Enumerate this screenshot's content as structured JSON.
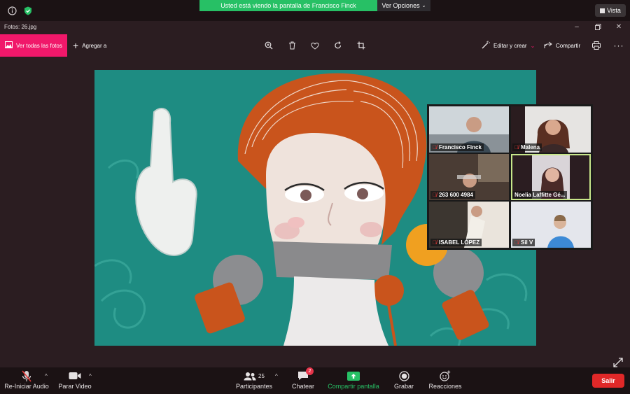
{
  "zoom": {
    "share_banner": "Usted está viendo la pantalla de Francisco Finck",
    "view_options": "Ver Opciones",
    "vista": "Vista",
    "controls": {
      "audio": "Re-Iniciar Audio",
      "video": "Parar Video",
      "participants": "Participantes",
      "participants_count": "25",
      "chat": "Chatear",
      "chat_badge": "2",
      "share": "Compartir pantalla",
      "record": "Grabar",
      "reactions": "Reacciones",
      "leave": "Salir"
    },
    "accent_green": "#27c065",
    "leave_red": "#e02828"
  },
  "photos": {
    "title": "Fotos: 26.jpg",
    "see_all": "Ver todas las fotos",
    "add_to": "Agregar a",
    "edit_create": "Editar y crear",
    "share": "Compartir",
    "accent_pink": "#f0186a"
  },
  "gallery": {
    "participants": [
      {
        "name": "Francisco Finck",
        "muted": true
      },
      {
        "name": "Malena",
        "muted": true
      },
      {
        "name": "263 600 4984",
        "muted": true
      },
      {
        "name": "Noelia Laffitte Gé...",
        "muted": false,
        "active": true
      },
      {
        "name": "ISABEL LÓPEZ",
        "muted": true
      },
      {
        "name": "Sil V",
        "muted": true
      }
    ]
  }
}
